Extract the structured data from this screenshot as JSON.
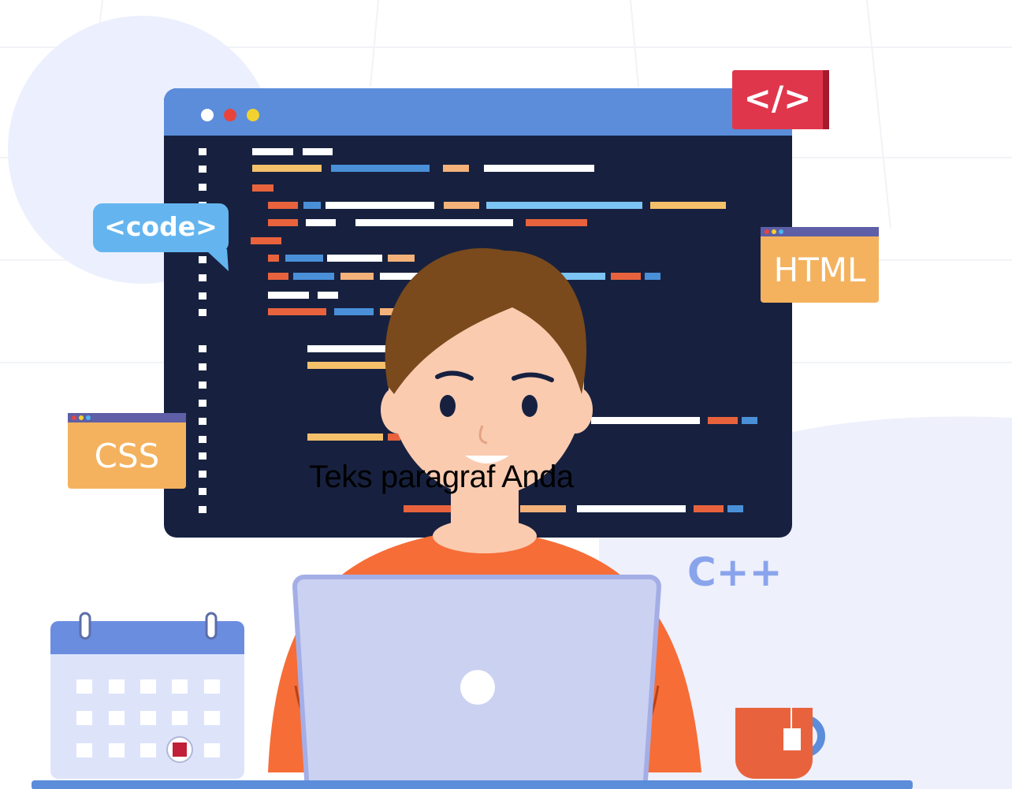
{
  "badges": {
    "code_tag": "<code>",
    "html": "HTML",
    "css": "CSS",
    "cpp": "C++",
    "closing_tag": "</>"
  },
  "caption": "Teks paragraf Anda",
  "colors": {
    "window_bar": "#5b8ddb",
    "editor_bg": "#17213f",
    "badge_orange": "#f4b25e",
    "badge_red": "#e0364c",
    "code_bubble": "#64b5ef",
    "shirt": "#f66d37",
    "laptop": "#cbd1f1",
    "hair": "#7a4a1c",
    "skin": "#fbcbb0",
    "calendar_header": "#6b8de0"
  },
  "icons": [
    "window-dots-icon",
    "code-tag-bubble-icon",
    "closing-tag-icon",
    "html-badge-icon",
    "css-badge-icon",
    "cpp-icon",
    "calendar-icon",
    "laptop-icon",
    "mug-icon"
  ]
}
